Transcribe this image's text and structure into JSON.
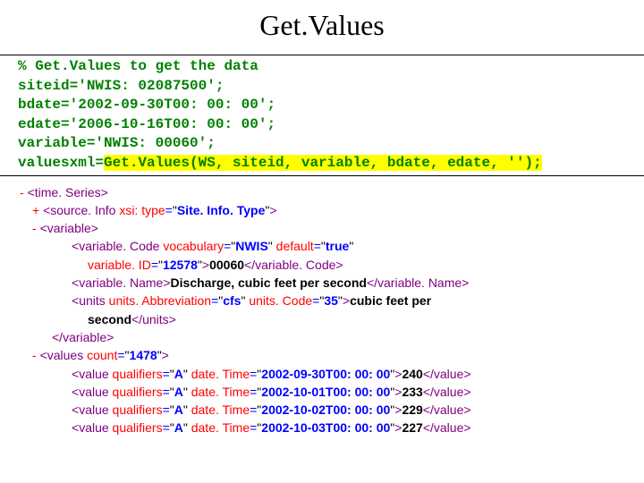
{
  "title": "Get.Values",
  "code": {
    "l1": "% Get.Values to get the data",
    "l2": "siteid='NWIS: 02087500';",
    "l3": "bdate='2002-09-30T00: 00: 00';",
    "l4": "edate='2006-10-16T00: 00: 00';",
    "l5": "variable='NWIS: 00060';",
    "l6a": "valuesxml=",
    "l6b": "Get.Values(WS, siteid, variable, bdate, edate, '');"
  },
  "xml": {
    "t_open": "-",
    "t_plus": "+",
    "timeSeries": "time. Series",
    "sourceInfo": "source. Info",
    "xsi_attr": "xsi: type",
    "siteInfoType": "Site. Info. Type",
    "variable": "variable",
    "variableCode": "variable. Code",
    "vocab_attr": "vocabulary",
    "vocab_val": "NWIS",
    "default_attr": "default",
    "default_val": "true",
    "varID_attr": "variable. ID",
    "varID_val": "12578",
    "varCode_txt": "00060",
    "variableName": "variable. Name",
    "variableName_txt": "Discharge, cubic feet per second",
    "units": "units",
    "unitsAbbr_attr": "units. Abbreviation",
    "unitsAbbr_val": "cfs",
    "unitsCode_attr": "units. Code",
    "unitsCode_val": "35",
    "units_txt1": "cubic feet per",
    "units_txt2": "second",
    "values": "values",
    "count_attr": "count",
    "count_val": "1478",
    "value": "value",
    "qual_attr": "qualifiers",
    "qual_val": "A",
    "dt_attr": "date. Time",
    "rows": [
      {
        "dt": "2002-09-30T00: 00: 00",
        "v": "240"
      },
      {
        "dt": "2002-10-01T00: 00: 00",
        "v": "233"
      },
      {
        "dt": "2002-10-02T00: 00: 00",
        "v": "229"
      },
      {
        "dt": "2002-10-03T00: 00: 00",
        "v": "227"
      }
    ]
  }
}
